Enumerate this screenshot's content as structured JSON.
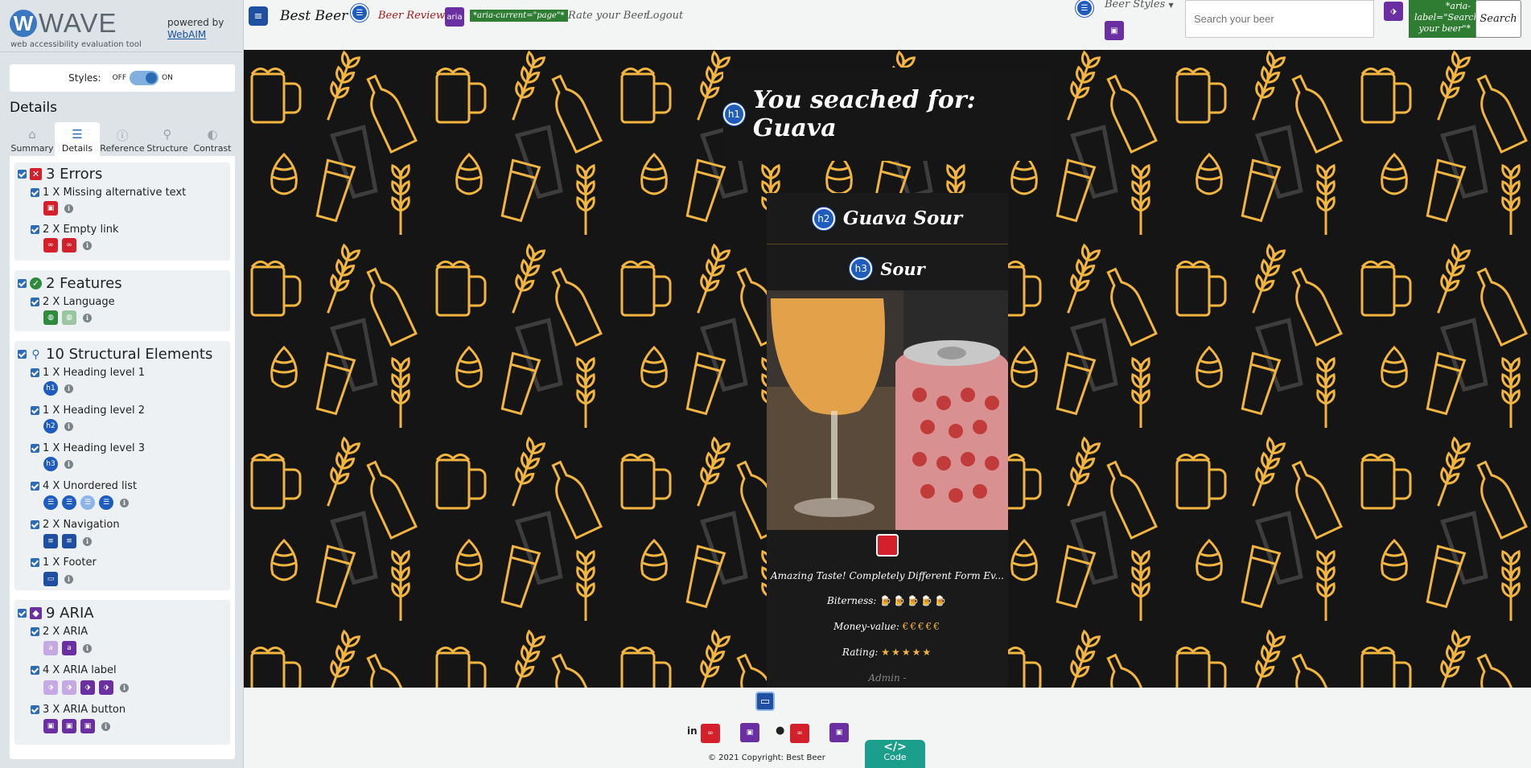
{
  "wave": {
    "logo_word": "WAVE",
    "subtitle": "web accessibility evaluation tool",
    "powered_by": "powered by",
    "webaim_link": "WebAIM",
    "styles_label": "Styles:",
    "styles_off": "OFF",
    "styles_on": "ON",
    "details_title": "Details",
    "tabs": [
      {
        "label": "Summary",
        "icon": "home-icon"
      },
      {
        "label": "Details",
        "icon": "list-icon"
      },
      {
        "label": "Reference",
        "icon": "info-icon"
      },
      {
        "label": "Structure",
        "icon": "structure-icon"
      },
      {
        "label": "Contrast",
        "icon": "contrast-icon"
      }
    ],
    "active_tab": "Details",
    "groups": {
      "errors": {
        "title": "3 Errors",
        "items": [
          {
            "label": "1 X Missing alternative text",
            "icons": 1
          },
          {
            "label": "2 X Empty link",
            "icons": 2
          }
        ]
      },
      "features": {
        "title": "2 Features",
        "items": [
          {
            "label": "2 X Language",
            "icons": 2
          }
        ]
      },
      "structure": {
        "title": "10 Structural Elements",
        "items": [
          {
            "label": "1 X Heading level 1",
            "icons": [
              "h1"
            ]
          },
          {
            "label": "1 X Heading level 2",
            "icons": [
              "h2"
            ]
          },
          {
            "label": "1 X Heading level 3",
            "icons": [
              "h3"
            ]
          },
          {
            "label": "4 X Unordered list",
            "icons": 4
          },
          {
            "label": "2 X Navigation",
            "icons": 2
          },
          {
            "label": "1 X Footer",
            "icons": 1
          }
        ]
      },
      "aria": {
        "title": "9 ARIA",
        "items": [
          {
            "label": "2 X ARIA",
            "icons": 2
          },
          {
            "label": "4 X ARIA label",
            "icons": 4
          },
          {
            "label": "3 X ARIA button",
            "icons": 3
          }
        ]
      }
    }
  },
  "page": {
    "brand": "Best Beer",
    "nav": {
      "beer_reviews": "Beer Reviews",
      "aria_current": "*aria-current=\"page\"*",
      "rate": "Rate your Beer",
      "logout": "Logout",
      "beer_styles": "Beer Styles",
      "aria_badge": "aria"
    },
    "search": {
      "placeholder": "Search your beer",
      "button": "Search",
      "aria_label_note": "*aria-label=\"Search your beer\"*"
    },
    "heading_badges": {
      "h1": "h1",
      "h2": "h2",
      "h3": "h3"
    },
    "title": "You seached for: Guava",
    "card": {
      "name": "Guava Sour",
      "style": "Sour",
      "description": "Amazing Taste! Completely Different Form Ev...",
      "bitterness_label": "Biterness:",
      "bitterness_value": "🍺🍺🍺🍺🍺",
      "money_label": "Money-value:",
      "money_value": "€€€€€",
      "rating_label": "Rating:",
      "rating_value": "★★★★★",
      "author": "Admin -"
    },
    "footer": {
      "copyright": "© 2021 Copyright: Best Beer",
      "code_label": "Code",
      "code_symbol": "</>"
    }
  },
  "colors": {
    "wave_blue": "#2c6bb5",
    "error_red": "#d4202a",
    "feature_green": "#2e8b3e",
    "aria_purple": "#6a2fa0",
    "pattern_gold": "#f2b540",
    "note_green": "#2e7d32",
    "code_teal": "#1b9f8c"
  }
}
